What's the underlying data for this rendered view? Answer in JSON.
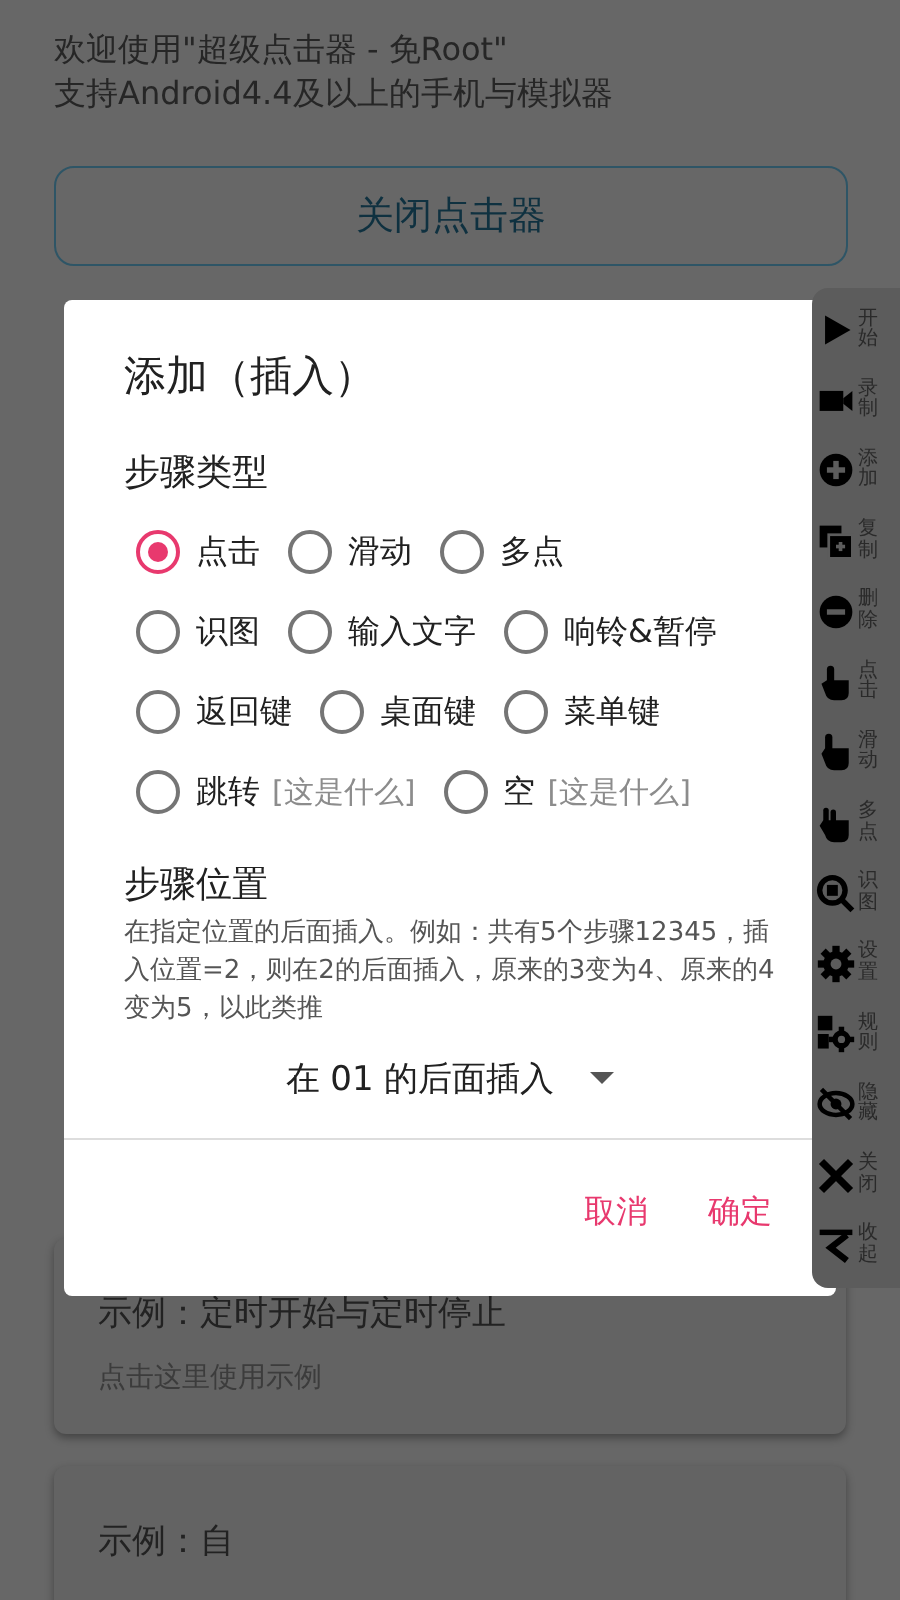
{
  "header": {
    "lines": [
      "欢迎使用\"超级点击器 - 免Root\"",
      "支持Android4.4及以上的手机与模拟器"
    ]
  },
  "close_button": {
    "label": "关闭点击器"
  },
  "examples": [
    {
      "title": "示例：定时开始与定时停止",
      "hint": "点击这里使用示例"
    },
    {
      "title": "示例：自"
    }
  ],
  "dialog": {
    "title": "添加（插入）",
    "step_type": {
      "heading": "步骤类型",
      "options": [
        {
          "label": "点击",
          "selected": true
        },
        {
          "label": "滑动",
          "selected": false
        },
        {
          "label": "多点",
          "selected": false
        },
        {
          "label": "识图",
          "selected": false
        },
        {
          "label": "输入文字",
          "selected": false
        },
        {
          "label": "响铃&暂停",
          "selected": false
        },
        {
          "label": "返回键",
          "selected": false
        },
        {
          "label": "桌面键",
          "selected": false
        },
        {
          "label": "菜单键",
          "selected": false
        },
        {
          "label": "跳转",
          "selected": false,
          "help": "[这是什么]"
        },
        {
          "label": "空",
          "selected": false,
          "help": "[这是什么]"
        }
      ]
    },
    "position": {
      "heading": "步骤位置",
      "description": "在指定位置的后面插入。例如：共有5个步骤12345，插入位置=2，则在2的后面插入，原来的3变为4、原来的4变为5，以此类推",
      "value": "在 01 的后面插入"
    },
    "buttons": [
      "取消",
      "确定"
    ]
  },
  "toolbar": [
    {
      "kind": "play",
      "label": "开始"
    },
    {
      "kind": "record",
      "label": "录制"
    },
    {
      "kind": "add",
      "label": "添加"
    },
    {
      "kind": "copy",
      "label": "复制"
    },
    {
      "kind": "remove",
      "label": "删除"
    },
    {
      "kind": "tap",
      "label": "点击"
    },
    {
      "kind": "swipe",
      "label": "滑动"
    },
    {
      "kind": "multi",
      "label": "多点"
    },
    {
      "kind": "find",
      "label": "识图"
    },
    {
      "kind": "settings",
      "label": "设置"
    },
    {
      "kind": "rules",
      "label": "规则"
    },
    {
      "kind": "hide",
      "label": "隐藏"
    },
    {
      "kind": "close",
      "label": "关闭"
    },
    {
      "kind": "collapse",
      "label": "收起"
    }
  ]
}
